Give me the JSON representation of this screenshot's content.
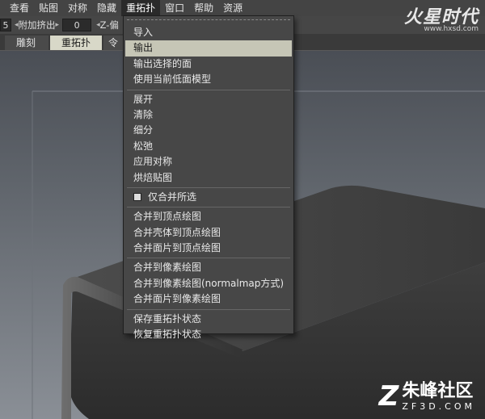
{
  "menubar": {
    "items": [
      {
        "label": "查看"
      },
      {
        "label": "贴图"
      },
      {
        "label": "对称"
      },
      {
        "label": "隐藏"
      },
      {
        "label": "重拓扑"
      },
      {
        "label": "窗口"
      },
      {
        "label": "帮助"
      },
      {
        "label": "资源"
      }
    ],
    "active_index": 4
  },
  "toolbar": {
    "left_value": "5",
    "extrude_label": "附加挤出",
    "extrude_value": "0",
    "axis_label": "Z-偏"
  },
  "tabs": [
    {
      "label": "雕刻"
    },
    {
      "label": "重拓扑"
    },
    {
      "label": "令"
    }
  ],
  "dropdown": {
    "groups": [
      [
        "导入",
        "输出",
        "输出选择的面",
        "使用当前低面模型"
      ],
      [
        "展开",
        "清除",
        "细分",
        "松弛",
        "应用对称",
        "烘焙贴图"
      ],
      [
        "仅合并所选"
      ],
      [
        "合并到顶点绘图",
        "合并壳体到顶点绘图",
        "合并面片到顶点绘图"
      ],
      [
        "合并到像素绘图",
        "合并到像素绘图(normalmap方式)",
        "合并面片到像素绘图"
      ],
      [
        "保存重拓扑状态",
        "恢复重拓扑状态"
      ]
    ],
    "highlighted": "输出",
    "checkbox_item": "仅合并所选"
  },
  "logos": {
    "hxsd_main": "火星时代",
    "hxsd_url": "www.hxsd.com",
    "zf3d_main": "朱峰社区",
    "zf3d_sub": "ZF3D.COM"
  },
  "colors": {
    "menu_bg": "#474747",
    "highlight": "#c6c6b6",
    "active_tab": "#d8d8c8"
  }
}
